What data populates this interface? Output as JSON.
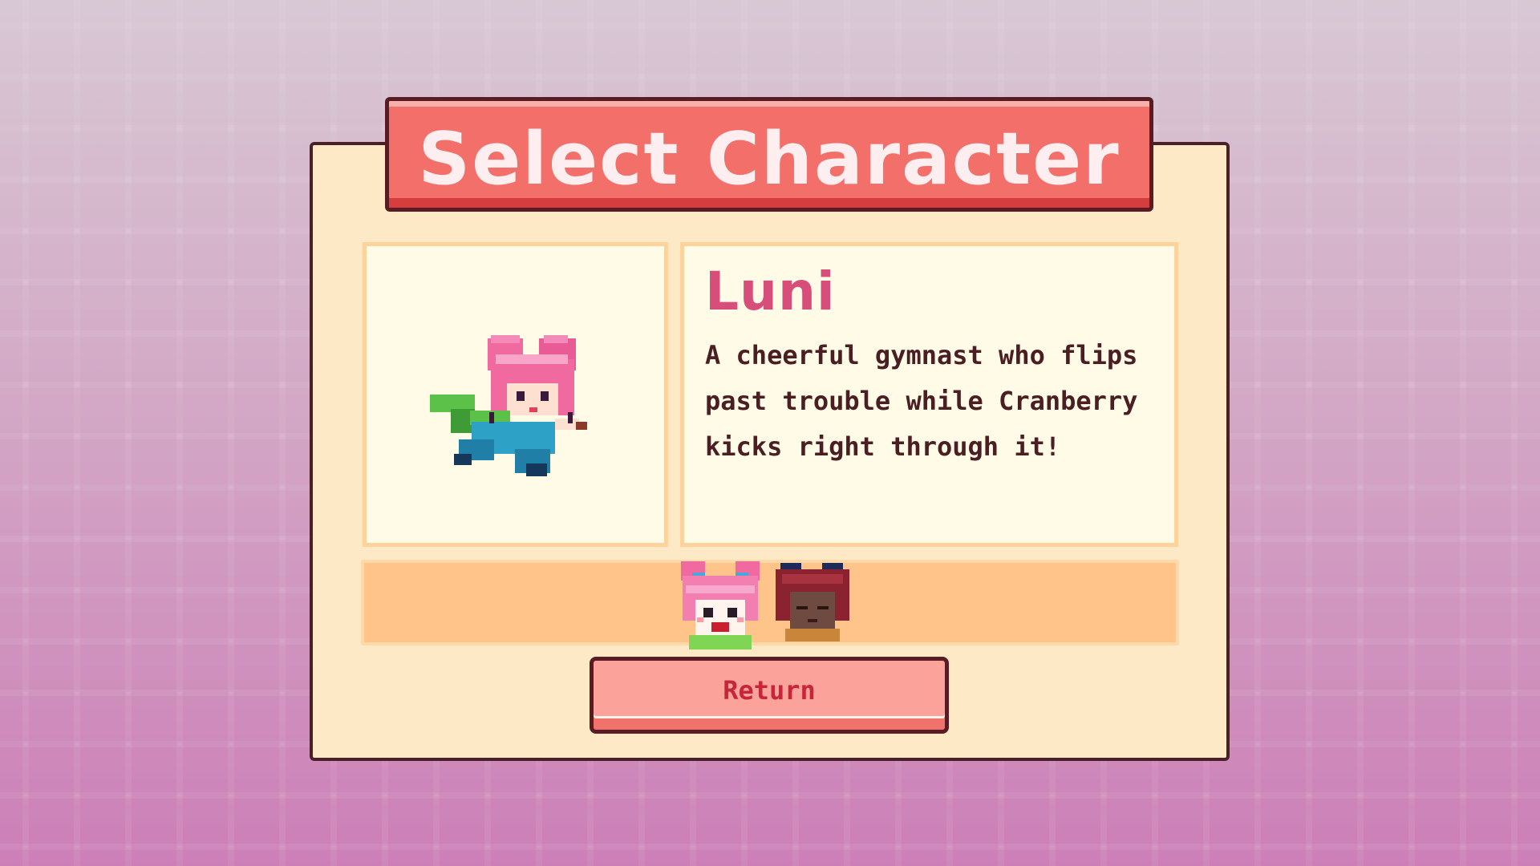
{
  "screen": {
    "title": "Select Character"
  },
  "selected_character": {
    "name": "Luni",
    "description": "A cheerful gymnast who flips past trouble while Cranberry kicks right through it!",
    "portrait_icon": "luni-sprite-icon"
  },
  "roster": [
    {
      "icon": "luni-face-icon",
      "selected": true
    },
    {
      "icon": "cranberry-face-icon",
      "selected": false
    }
  ],
  "buttons": {
    "return_label": "Return"
  },
  "colors": {
    "accent": "#f36f69",
    "name_color": "#d84e7a",
    "panel_bg": "#fde9c6",
    "button_text": "#c72638"
  }
}
